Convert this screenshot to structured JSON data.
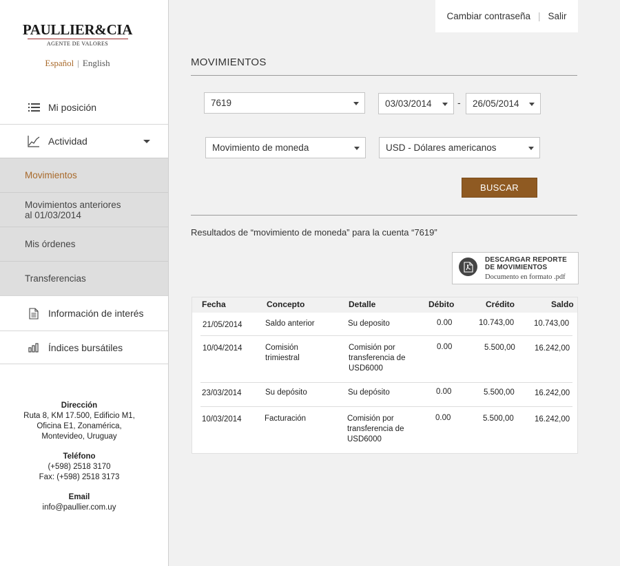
{
  "brand": {
    "name": "PAULLIER&CIA",
    "tagline": "AGENTE DE VALORES"
  },
  "languages": {
    "active": "Español",
    "separator": "|",
    "other": "English"
  },
  "topbar": {
    "change_password": "Cambiar contraseña",
    "separator": "|",
    "logout": "Salir"
  },
  "nav": {
    "position": "Mi posición",
    "activity": "Actividad",
    "sub": [
      "Movimientos",
      "Movimientos anteriores",
      "al 01/03/2014",
      "Mis órdenes",
      "Transferencias"
    ],
    "info": "Información de interés",
    "indices": "Índices bursátiles"
  },
  "contact": {
    "address_label": "Dirección",
    "address_lines": [
      "Ruta 8, KM 17.500, Edificio M1,",
      "Oficina E1, Zonamérica,",
      "Montevideo, Uruguay"
    ],
    "phone_label": "Teléfono",
    "phone": "(+598) 2518 3170",
    "fax": "Fax: (+598) 2518 3173",
    "email_label": "Email",
    "email": "info@paullier.com.uy"
  },
  "main": {
    "title": "MOVIMIENTOS",
    "filters": {
      "account": "7619",
      "date_from": "03/03/2014",
      "date_sep": "-",
      "date_to": "26/05/2014",
      "movement_type": "Movimiento de moneda",
      "currency": "USD - Dólares americanos"
    },
    "search_button": "BUSCAR",
    "results_text": "Resultados de “movimiento de moneda” para la cuenta “7619”",
    "download": {
      "title_line1": "DESCARGAR REPORTE",
      "title_line2": "DE MOVIMIENTOS",
      "subtitle": "Documento en formato .pdf"
    },
    "table": {
      "headers": [
        "Fecha",
        "Concepto",
        "Detalle",
        "Débito",
        "Crédito",
        "Saldo"
      ],
      "rows": [
        {
          "fecha": "21/05/2014",
          "concepto": [
            "Saldo anterior"
          ],
          "detalle": [
            "Su deposito"
          ],
          "debito": "0.00",
          "credito": "10.743,00",
          "saldo": "10.743,00"
        },
        {
          "fecha": "10/04/2014",
          "concepto": [
            "Comisión",
            "trimiestral"
          ],
          "detalle": [
            "Comisión por",
            "transferencia de",
            "USD6000"
          ],
          "debito": "0.00",
          "credito": "5.500,00",
          "saldo": "16.242,00"
        },
        {
          "fecha": "23/03/2014",
          "concepto": [
            "Su depósito"
          ],
          "detalle": [
            "Su depósito"
          ],
          "debito": "0.00",
          "credito": "5.500,00",
          "saldo": "16.242,00"
        },
        {
          "fecha": "10/03/2014",
          "concepto": [
            "Facturación"
          ],
          "detalle": [
            "Comisión por",
            "transferencia de",
            "USD6000"
          ],
          "debito": "0.00",
          "credito": "5.500,00",
          "saldo": "16.242,00"
        }
      ]
    }
  },
  "colors": {
    "accent": "#a8692a",
    "button": "#8f5a22",
    "logo_rule": "#9b2a2a"
  },
  "icons": [
    "list-icon",
    "chart-line-icon",
    "chevron-down-icon",
    "document-icon",
    "bar-chart-icon",
    "pdf-icon"
  ]
}
